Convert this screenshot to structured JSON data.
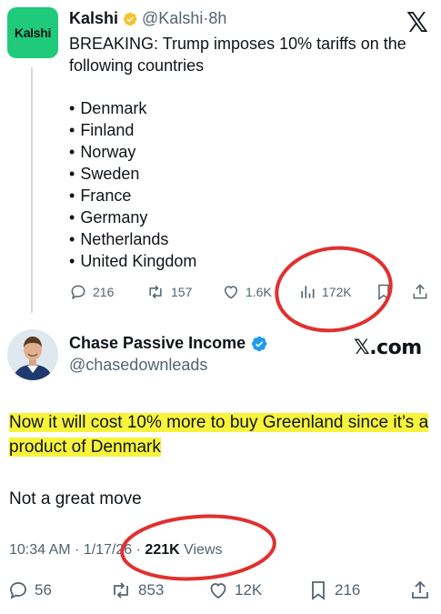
{
  "tweet1": {
    "avatar_text": "Kalshi",
    "name": "Kalshi",
    "handle": "@Kalshi",
    "separator": "·",
    "time": "8h",
    "platform_logo": "𝕏",
    "text": "BREAKING: Trump imposes 10% tariffs on the following countries",
    "countries": [
      "Denmark",
      "Finland",
      "Norway",
      "Sweden",
      "France",
      "Germany",
      "Netherlands",
      "United Kingdom"
    ],
    "actions": {
      "replies": "216",
      "reposts": "157",
      "likes": "1.6K",
      "views": "172K"
    },
    "icons": [
      "reply-icon",
      "repost-icon",
      "like-icon",
      "views-icon",
      "bookmark-icon",
      "share-icon"
    ]
  },
  "tweet2": {
    "name": "Chase Passive Income",
    "handle": "@chasedownleads",
    "watermark": "𝕏.com",
    "text_highlighted": "Now it will cost 10% more to buy Greenland since it’s a product of Denmark",
    "text_second": "Not a great move",
    "timestamp": "10:34 AM · 1/17/26 · ",
    "views_count": "221K",
    "views_label": " Views",
    "actions": {
      "replies": "56",
      "reposts": "853",
      "likes": "12K",
      "bookmarks": "216"
    }
  },
  "colors": {
    "kalshi_green": "#1fca7a",
    "verified_gold": "#f4c430",
    "verified_blue": "#1d9bf0",
    "highlight_yellow": "#f7f43b",
    "annotation_red": "#e0302f",
    "muted_text": "#536471"
  }
}
